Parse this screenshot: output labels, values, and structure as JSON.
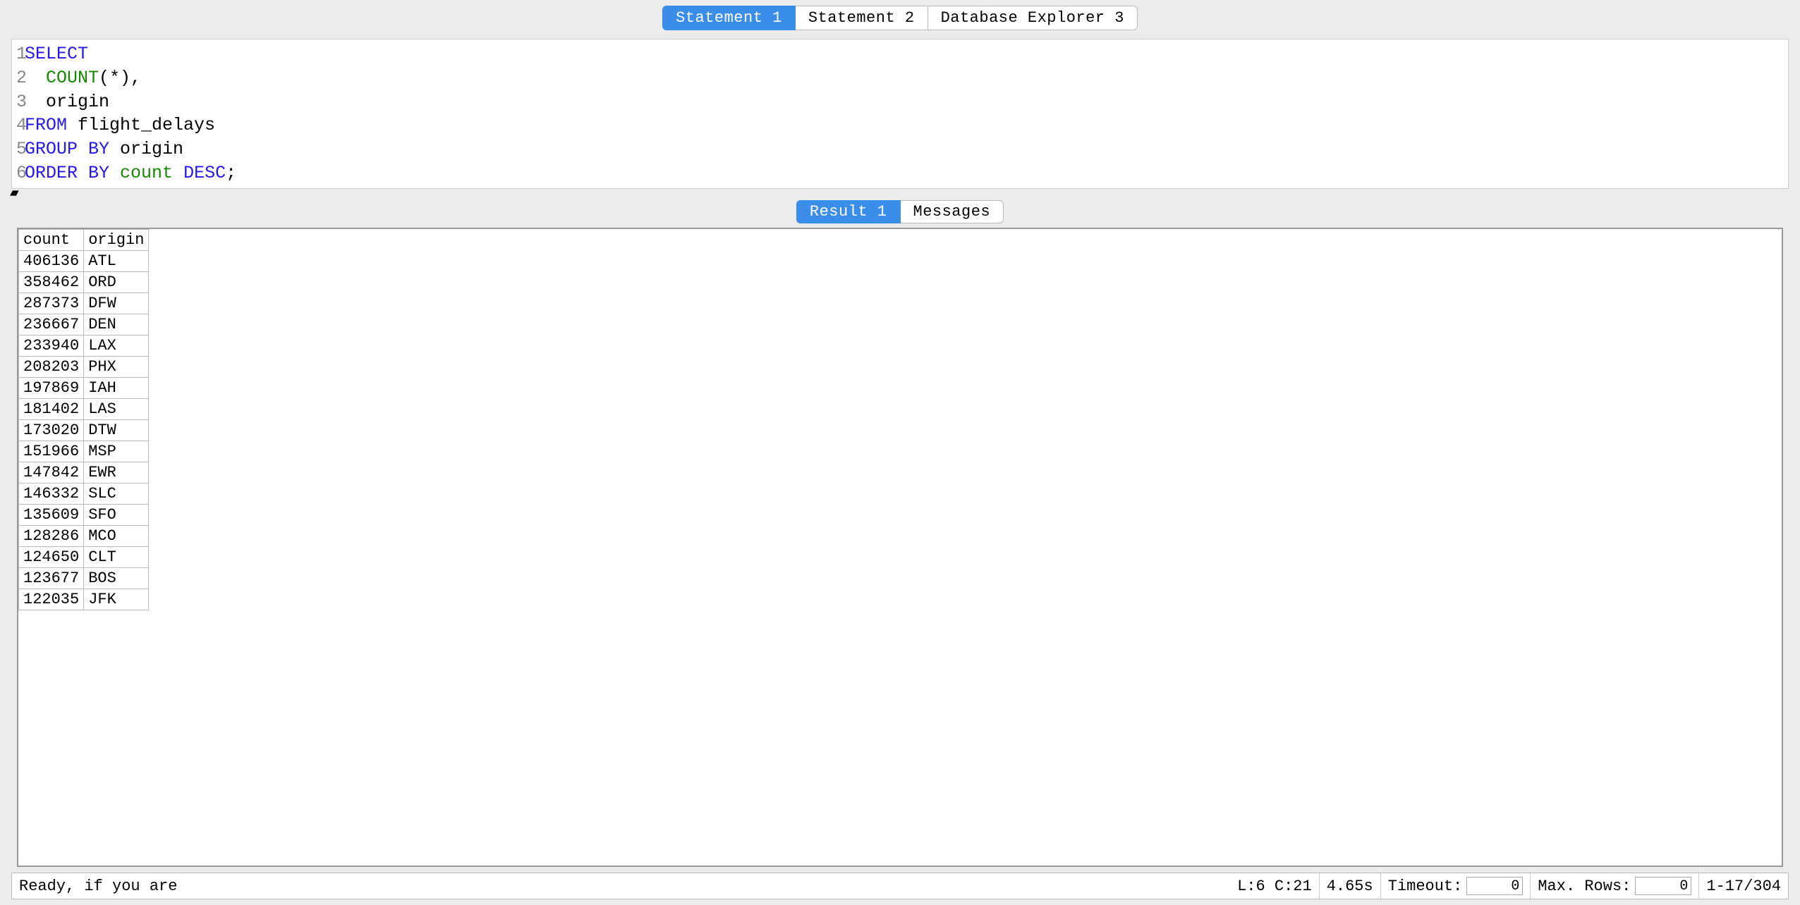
{
  "top_tabs": [
    {
      "label": "Statement 1",
      "active": true
    },
    {
      "label": "Statement 2",
      "active": false
    },
    {
      "label": "Database Explorer 3",
      "active": false
    }
  ],
  "editor": {
    "lines": [
      {
        "no": "1",
        "tokens": [
          {
            "t": "SELECT",
            "c": "kw"
          }
        ]
      },
      {
        "no": "2",
        "tokens": [
          {
            "t": "  ",
            "c": ""
          },
          {
            "t": "COUNT",
            "c": "fn"
          },
          {
            "t": "(*),",
            "c": ""
          }
        ]
      },
      {
        "no": "3",
        "tokens": [
          {
            "t": "  origin",
            "c": ""
          }
        ]
      },
      {
        "no": "4",
        "tokens": [
          {
            "t": "FROM",
            "c": "kw"
          },
          {
            "t": " flight_delays",
            "c": ""
          }
        ]
      },
      {
        "no": "5",
        "tokens": [
          {
            "t": "GROUP BY",
            "c": "kw"
          },
          {
            "t": " origin",
            "c": ""
          }
        ]
      },
      {
        "no": "6",
        "tokens": [
          {
            "t": "ORDER BY",
            "c": "kw"
          },
          {
            "t": " ",
            "c": ""
          },
          {
            "t": "count",
            "c": "fn"
          },
          {
            "t": " ",
            "c": ""
          },
          {
            "t": "DESC",
            "c": "kw"
          },
          {
            "t": ";",
            "c": ""
          }
        ]
      }
    ]
  },
  "result_tabs": [
    {
      "label": "Result 1",
      "active": true
    },
    {
      "label": "Messages",
      "active": false
    }
  ],
  "result": {
    "columns": [
      "count",
      "origin"
    ],
    "rows": [
      [
        "406136",
        "ATL"
      ],
      [
        "358462",
        "ORD"
      ],
      [
        "287373",
        "DFW"
      ],
      [
        "236667",
        "DEN"
      ],
      [
        "233940",
        "LAX"
      ],
      [
        "208203",
        "PHX"
      ],
      [
        "197869",
        "IAH"
      ],
      [
        "181402",
        "LAS"
      ],
      [
        "173020",
        "DTW"
      ],
      [
        "151966",
        "MSP"
      ],
      [
        "147842",
        "EWR"
      ],
      [
        "146332",
        "SLC"
      ],
      [
        "135609",
        "SFO"
      ],
      [
        "128286",
        "MCO"
      ],
      [
        "124650",
        "CLT"
      ],
      [
        "123677",
        "BOS"
      ],
      [
        "122035",
        "JFK"
      ]
    ]
  },
  "statusbar": {
    "message": "Ready, if you are",
    "cursor": "L:6 C:21",
    "elapsed": "4.65s",
    "timeout_label": "Timeout:",
    "timeout_value": "0",
    "maxrows_label": "Max. Rows:",
    "maxrows_value": "0",
    "rowrange": "1-17/304"
  }
}
